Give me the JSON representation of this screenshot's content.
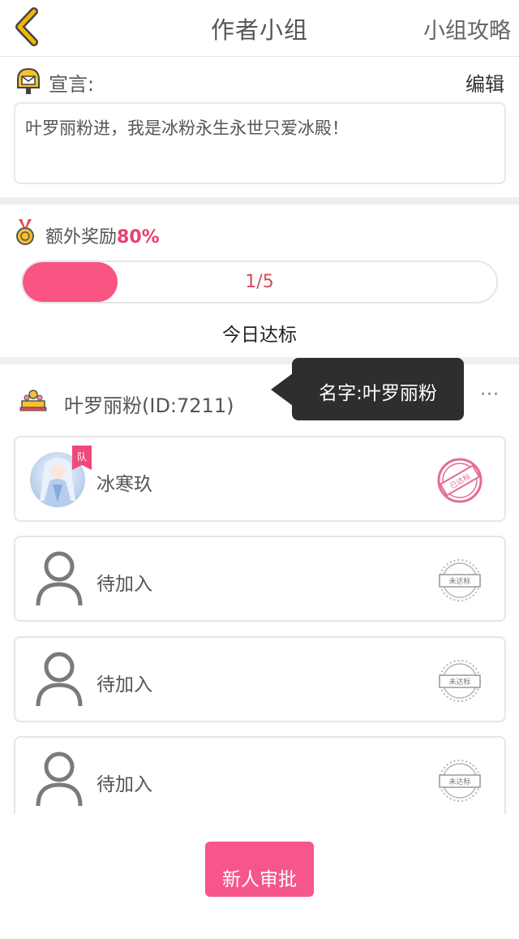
{
  "header": {
    "title": "作者小组",
    "guide_link": "小组攻略"
  },
  "declaration": {
    "label": "宣言:",
    "edit_label": "编辑",
    "text": "叶罗丽粉进，我是冰粉永生永世只爱冰殿！"
  },
  "bonus": {
    "label": "额外奖励",
    "value": "80%"
  },
  "progress": {
    "text": "1/5",
    "current": 1,
    "total": 5,
    "caption": "今日达标"
  },
  "group": {
    "name": "叶罗丽粉(ID:7211)",
    "more": "···"
  },
  "tooltip": {
    "text": "名字:叶罗丽粉"
  },
  "members": [
    {
      "name": "冰寒玖",
      "badge": "队",
      "status": "已达标",
      "avatar": "avatar-image"
    },
    {
      "name": "待加入",
      "status": "未达标",
      "avatar": "person-icon"
    },
    {
      "name": "待加入",
      "status": "未达标",
      "avatar": "person-icon"
    },
    {
      "name": "待加入",
      "status": "未达标",
      "avatar": "person-icon"
    }
  ],
  "actions": {
    "approve_label": "新人审批"
  },
  "colors": {
    "accent_pink": "#fa5483",
    "back_arrow": "#f2b705",
    "tooltip_bg": "#2e2e2e"
  }
}
